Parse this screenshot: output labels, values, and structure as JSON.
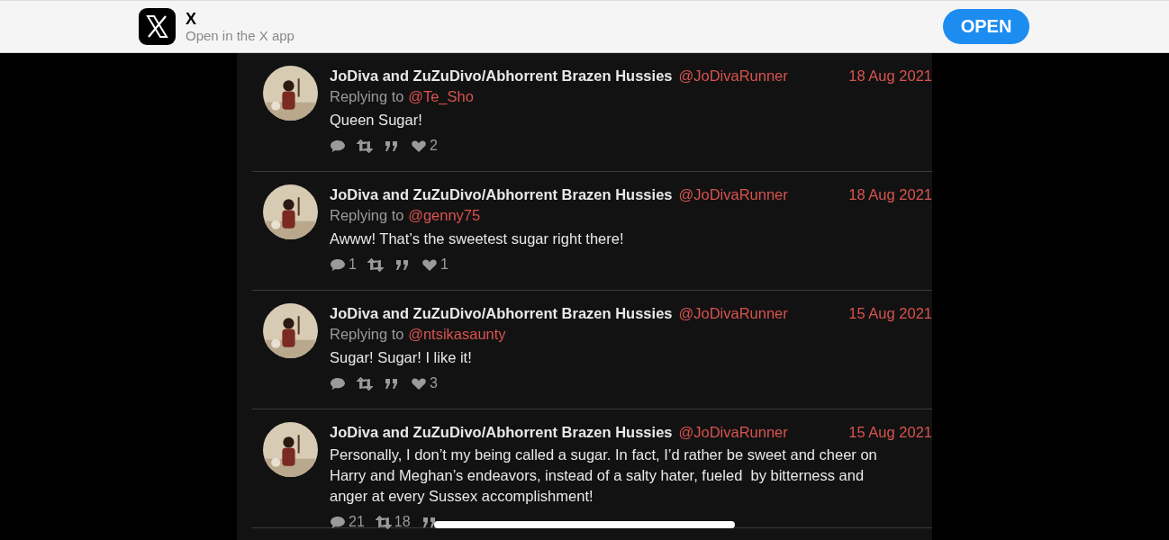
{
  "app_banner": {
    "title": "X",
    "subtitle": "Open in the X app",
    "button": "OPEN"
  },
  "tweets": [
    {
      "name": "JoDiva and ZuZuDivo/Abhorrent Brazen Hussies",
      "handle": "@JoDivaRunner",
      "date": "18 Aug 2021",
      "replying_to_label": "Replying to",
      "replying_to": "@Te_Sho",
      "text": "Queen Sugar!",
      "stats": [
        {
          "kind": "reply"
        },
        {
          "kind": "retweet"
        },
        {
          "kind": "quote"
        },
        {
          "kind": "like",
          "count": "2"
        }
      ]
    },
    {
      "name": "JoDiva and ZuZuDivo/Abhorrent Brazen Hussies",
      "handle": "@JoDivaRunner",
      "date": "18 Aug 2021",
      "replying_to_label": "Replying to",
      "replying_to": "@genny75",
      "text": "Awww! That’s the sweetest sugar right there!",
      "stats": [
        {
          "kind": "reply",
          "count": "1"
        },
        {
          "kind": "retweet"
        },
        {
          "kind": "quote"
        },
        {
          "kind": "like",
          "count": "1"
        }
      ]
    },
    {
      "name": "JoDiva and ZuZuDivo/Abhorrent Brazen Hussies",
      "handle": "@JoDivaRunner",
      "date": "15 Aug 2021",
      "replying_to_label": "Replying to",
      "replying_to": "@ntsikasaunty",
      "text": "Sugar! Sugar! I like it!",
      "stats": [
        {
          "kind": "reply"
        },
        {
          "kind": "retweet"
        },
        {
          "kind": "quote"
        },
        {
          "kind": "like",
          "count": "3"
        }
      ]
    },
    {
      "name": "JoDiva and ZuZuDivo/Abhorrent Brazen Hussies",
      "handle": "@JoDivaRunner",
      "date": "15 Aug 2021",
      "text": "Personally, I don’t my being called a sugar. In fact, I’d rather be sweet and cheer on Harry and Meghan’s endeavors, instead of a salty hater, fueled  by bitterness and anger at every Sussex accomplishment!",
      "stats": [
        {
          "kind": "reply",
          "count": "21"
        },
        {
          "kind": "retweet",
          "count": "18"
        },
        {
          "kind": "quote"
        }
      ]
    }
  ]
}
